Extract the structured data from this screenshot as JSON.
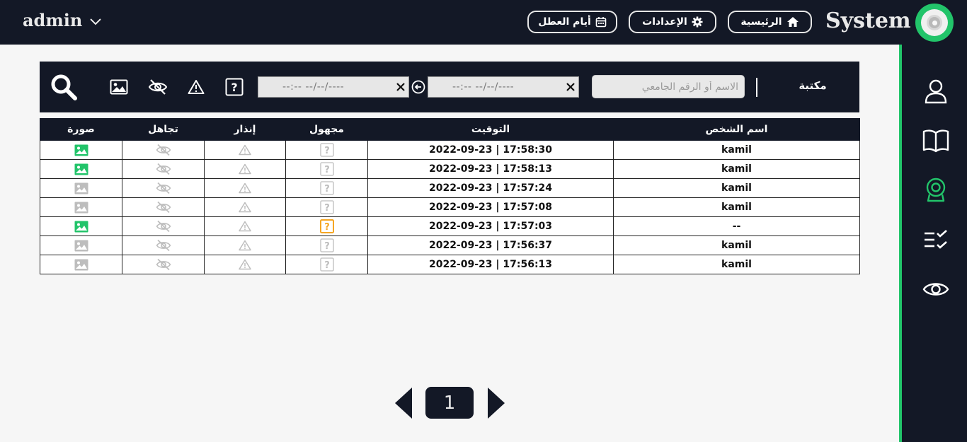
{
  "header": {
    "user_name": "admin",
    "brand": "System",
    "buttons": {
      "home": "الرئيسية",
      "settings": "الإعدادات",
      "holidays": "أيام العطل"
    }
  },
  "sidebar": {
    "items": [
      "user-icon",
      "book-icon",
      "camera-icon",
      "checklist-icon",
      "eye-icon"
    ],
    "active": "camera-icon",
    "accent_color": "#22c46a"
  },
  "filters": {
    "library_label": "مكتبة",
    "search_placeholder": "الاسم أو الرقم الجامعي",
    "date_from": "--:-- --/--/----",
    "date_to": "--:-- --/--/----"
  },
  "table": {
    "columns": [
      "اسم الشخص",
      "التوقيت",
      "مجهول",
      "إنذار",
      "تجاهل",
      "صورة"
    ],
    "rows": [
      {
        "name": "kamil",
        "time": "2022-09-23 | 17:58:30",
        "unknown": false,
        "image": true
      },
      {
        "name": "kamil",
        "time": "2022-09-23 | 17:58:13",
        "unknown": false,
        "image": true
      },
      {
        "name": "kamil",
        "time": "2022-09-23 | 17:57:24",
        "unknown": false,
        "image": false
      },
      {
        "name": "kamil",
        "time": "2022-09-23 | 17:57:08",
        "unknown": false,
        "image": false
      },
      {
        "name": "--",
        "time": "2022-09-23 | 17:57:03",
        "unknown": true,
        "image": true
      },
      {
        "name": "kamil",
        "time": "2022-09-23 | 17:56:37",
        "unknown": false,
        "image": false
      },
      {
        "name": "kamil",
        "time": "2022-09-23 | 17:56:13",
        "unknown": false,
        "image": false
      }
    ]
  },
  "pagination": {
    "current_page": "1"
  },
  "colors": {
    "dark": "#131826",
    "accent": "#22c46a",
    "warning": "#f5a623",
    "muted_icon": "#bdbdbd"
  }
}
